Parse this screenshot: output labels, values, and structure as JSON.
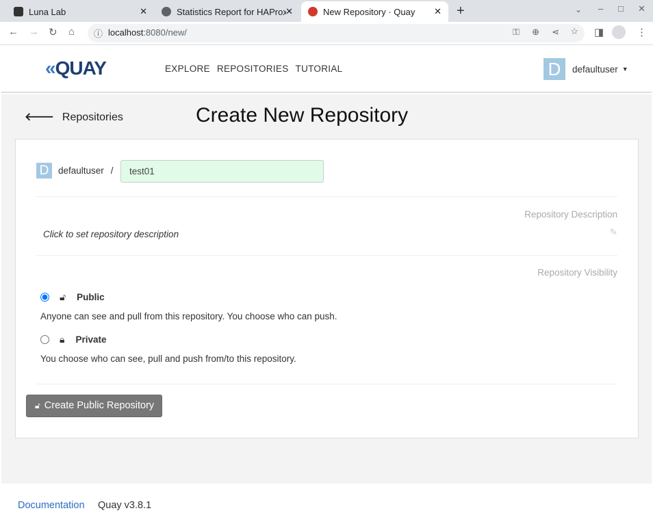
{
  "browser": {
    "tabs": [
      {
        "title": "Luna Lab"
      },
      {
        "title": "Statistics Report for HAProxy"
      },
      {
        "title": "New Repository · Quay"
      }
    ],
    "url_host": "localhost",
    "url_rest": ":8080/new/"
  },
  "nav": {
    "logo": "QUAY",
    "links": [
      "EXPLORE",
      "REPOSITORIES",
      "TUTORIAL"
    ],
    "avatar_letter": "D",
    "username": "defaultuser"
  },
  "page": {
    "back_label": "Repositories",
    "title": "Create New Repository"
  },
  "form": {
    "namespace": "defaultuser",
    "separator": "/",
    "repo_name": "test01",
    "description_label": "Repository Description",
    "description_placeholder": "Click to set repository description",
    "visibility_label": "Repository Visibility",
    "options": [
      {
        "label": "Public",
        "desc": "Anyone can see and pull from this repository. You choose who can push.",
        "selected": true
      },
      {
        "label": "Private",
        "desc": "You choose who can see, pull and push from/to this repository.",
        "selected": false
      }
    ],
    "submit_label": "Create Public Repository"
  },
  "footer": {
    "docs": "Documentation",
    "version": "Quay v3.8.1"
  }
}
